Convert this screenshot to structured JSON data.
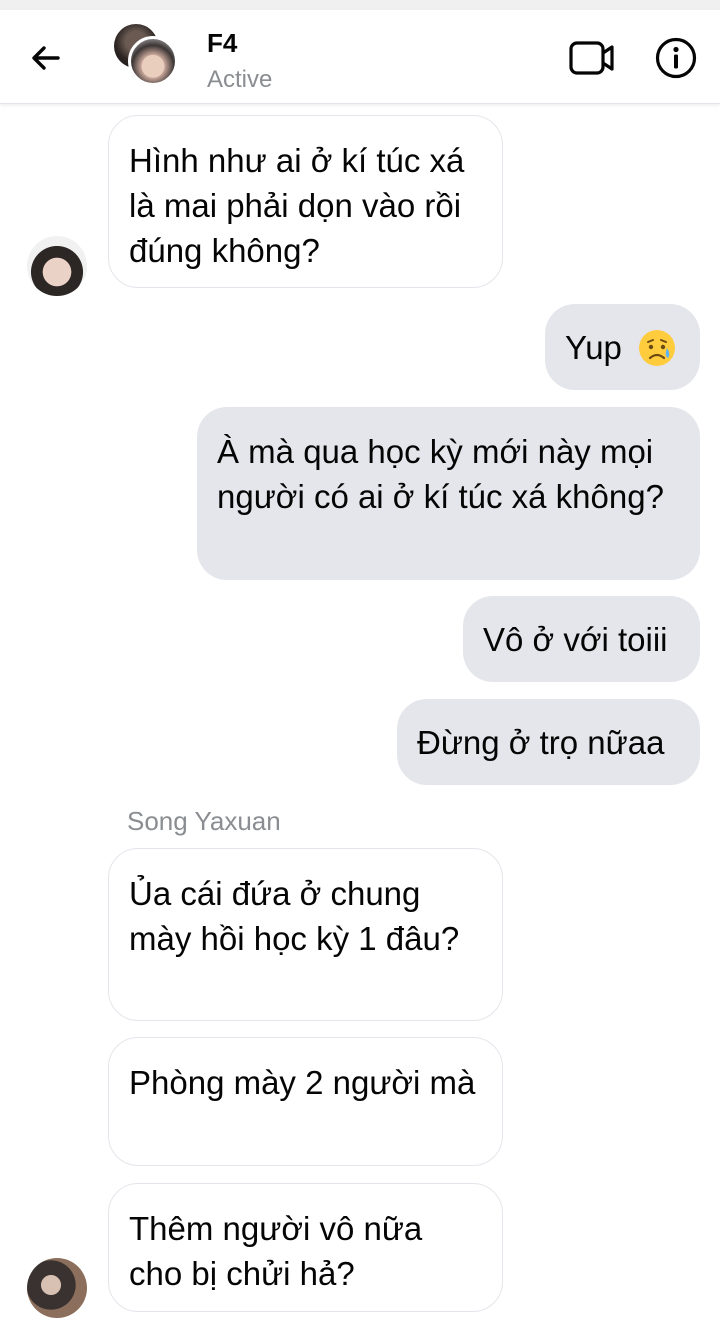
{
  "header": {
    "title": "F4",
    "status": "Active"
  },
  "messages": [
    {
      "text": "Hình như ai ở kí túc xá là mai phải dọn vào rồi đúng không?"
    },
    {
      "text": "Yup"
    },
    {
      "text": "À mà qua học kỳ mới này mọi người có ai ở kí túc xá không?"
    },
    {
      "text": "Vô ở với toiii"
    },
    {
      "text": "Đừng ở trọ nữaa"
    },
    {
      "text": "Ủa cái đứa ở chung mày hồi học kỳ 1 đâu?"
    },
    {
      "text": "Phòng mày 2 người mà"
    },
    {
      "text": "Thêm người vô nữa cho bị chửi hả?"
    }
  ],
  "sender_name": "Song Yaxuan",
  "icons": {
    "back": "arrow-left-icon",
    "video": "video-camera-icon",
    "info": "info-icon",
    "emoji": "sad-tear-emoji-icon"
  },
  "colors": {
    "incoming_bg": "#ffffff",
    "incoming_border": "#e4e6eb",
    "outgoing_bg": "#e4e6eb",
    "secondary_text": "#8a8d91"
  }
}
